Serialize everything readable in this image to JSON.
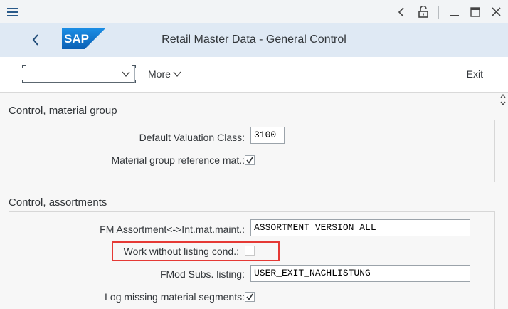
{
  "window": {
    "icons": [
      "menu-icon",
      "chevron-left-icon",
      "unlock-icon",
      "minimize-icon",
      "maximize-icon",
      "close-icon"
    ]
  },
  "header": {
    "title": "Retail Master Data - General Control",
    "logo_text": "SAP",
    "brand_color": "#0a6ed1"
  },
  "toolbar": {
    "dropdown_value": "",
    "more_label": "More",
    "exit_label": "Exit"
  },
  "groups": [
    {
      "title": "Control, material group",
      "fields": [
        {
          "label": "Default Valuation Class:",
          "type": "input",
          "value": "3100"
        },
        {
          "label": "Material group reference mat.:",
          "type": "checkbox",
          "checked": true
        }
      ]
    },
    {
      "title": "Control, assortments",
      "fields": [
        {
          "label": "FM Assortment<->Int.mat.maint.:",
          "type": "input",
          "value": "ASSORTMENT_VERSION_ALL"
        },
        {
          "label": "Work without listing cond.:",
          "type": "checkbox",
          "checked": false,
          "highlighted": true
        },
        {
          "label": "FMod Subs. listing:",
          "type": "input",
          "value": "USER_EXIT_NACHLISTUNG"
        },
        {
          "label": "Log missing material segments:",
          "type": "checkbox",
          "checked": true
        }
      ]
    }
  ],
  "colors": {
    "highlight": "#e53935",
    "header_bg": "#dfe9f4",
    "content_bg": "#f7f7f7"
  }
}
